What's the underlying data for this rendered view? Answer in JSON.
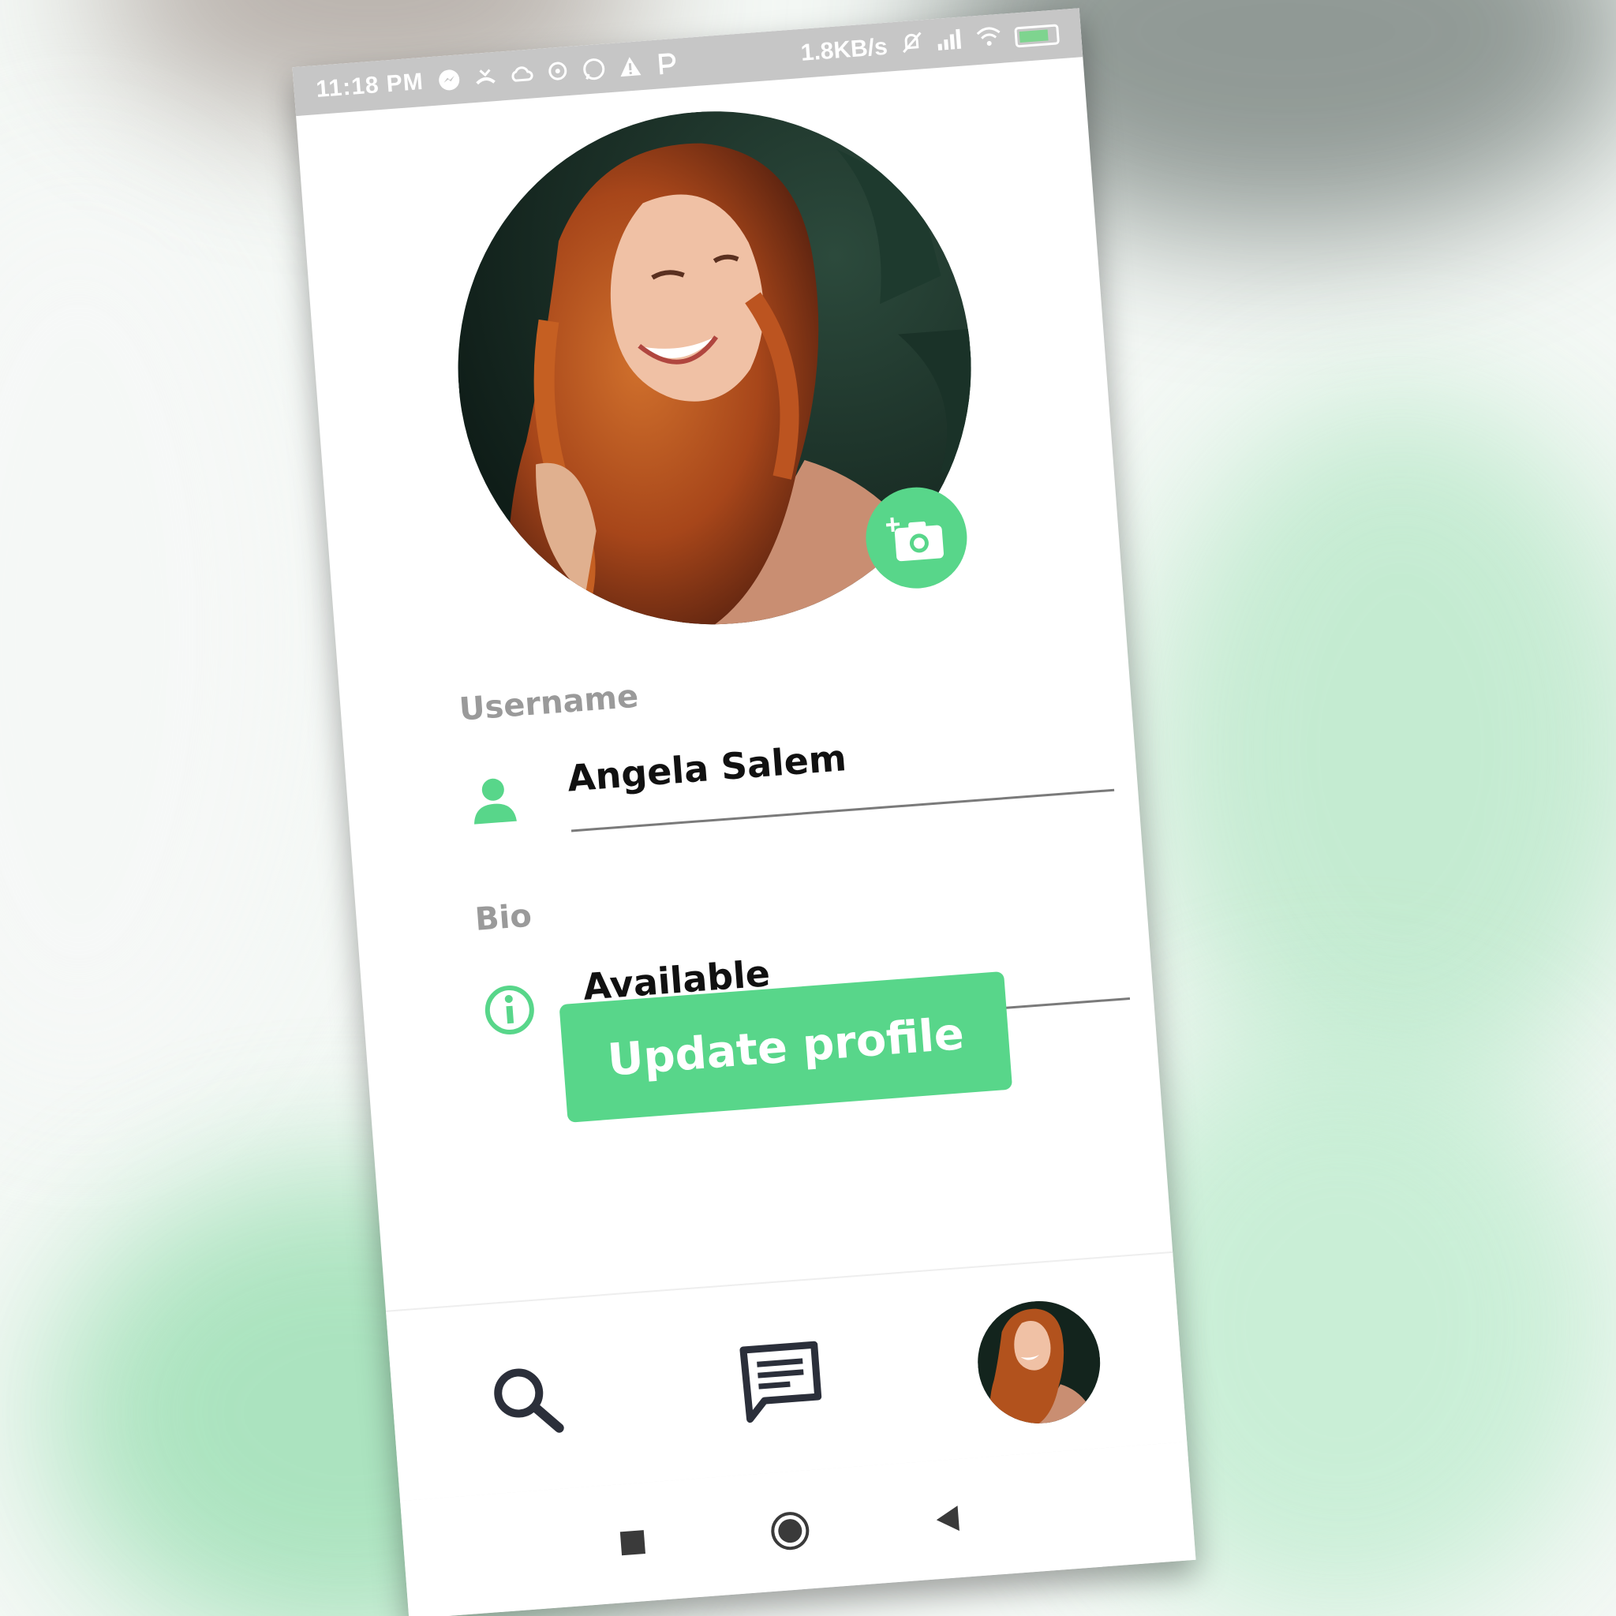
{
  "status_bar": {
    "time": "11:18 PM",
    "net_speed": "1.8KB/s",
    "left_icons": [
      "messenger-icon",
      "missed-call-icon",
      "cloud-icon",
      "sync-icon",
      "whatsapp-icon",
      "warning-icon",
      "p-icon"
    ],
    "right_icons": [
      "mute-icon",
      "signal-icon",
      "wifi-icon",
      "battery-icon"
    ]
  },
  "profile": {
    "avatar_alt": "Profile photo",
    "camera_button_icon": "add-photo-icon"
  },
  "username": {
    "label": "Username",
    "value": "Angela Salem",
    "icon": "person-icon"
  },
  "bio": {
    "label": "Bio",
    "value": "Available",
    "icon": "info-icon"
  },
  "actions": {
    "update_label": "Update profile"
  },
  "bottom_nav": {
    "items": [
      {
        "name": "search",
        "icon": "search-icon"
      },
      {
        "name": "chats",
        "icon": "chat-icon"
      },
      {
        "name": "profile",
        "icon": "avatar"
      }
    ]
  },
  "system_nav": [
    "recents-icon",
    "home-icon",
    "back-icon"
  ],
  "colors": {
    "accent": "#58d68a",
    "status_bar": "#c6c6c6",
    "label_gray": "#9a9a9a",
    "text": "#111111"
  }
}
